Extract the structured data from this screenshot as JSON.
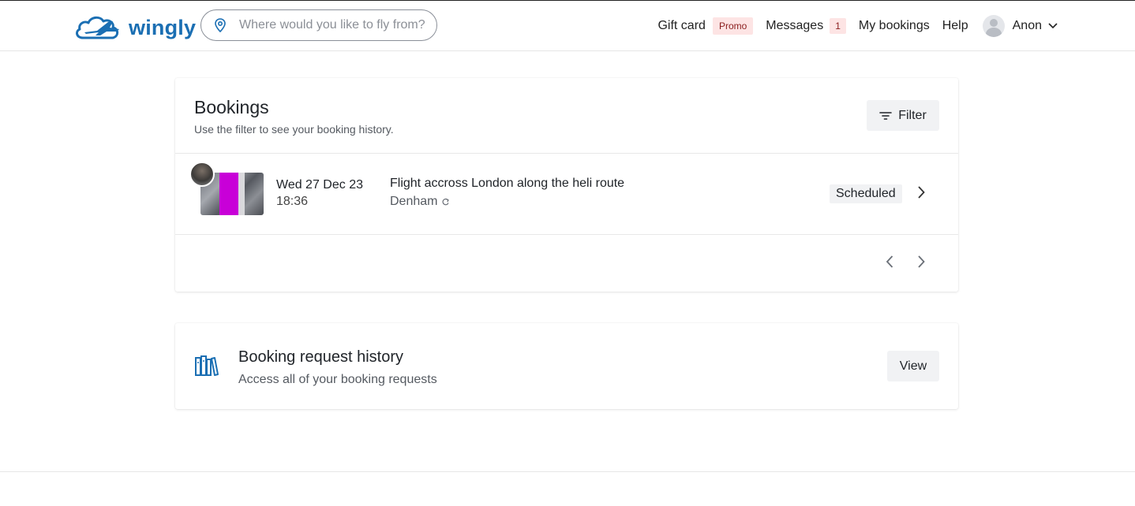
{
  "header": {
    "logo_text": "wingly",
    "search": {
      "placeholder": "Where would you like to fly from?",
      "value": ""
    },
    "nav": {
      "gift_card": "Gift card",
      "promo_badge": "Promo",
      "messages": "Messages",
      "messages_count": "1",
      "my_bookings": "My bookings",
      "help": "Help",
      "user_name": "Anon"
    }
  },
  "bookings": {
    "title": "Bookings",
    "subtitle": "Use the filter to see your booking history.",
    "filter_label": "Filter",
    "items": [
      {
        "date": "Wed 27 Dec 23",
        "time": "18:36",
        "title": "Flight accross London along the heli route",
        "place": "Denham",
        "status": "Scheduled"
      }
    ]
  },
  "history": {
    "title": "Booking request history",
    "subtitle": "Access all of your booking requests",
    "view_label": "View"
  },
  "colors": {
    "brand": "#1b6fb3",
    "badge_bg": "#fde4e4",
    "button_bg": "#f1f2f4"
  }
}
